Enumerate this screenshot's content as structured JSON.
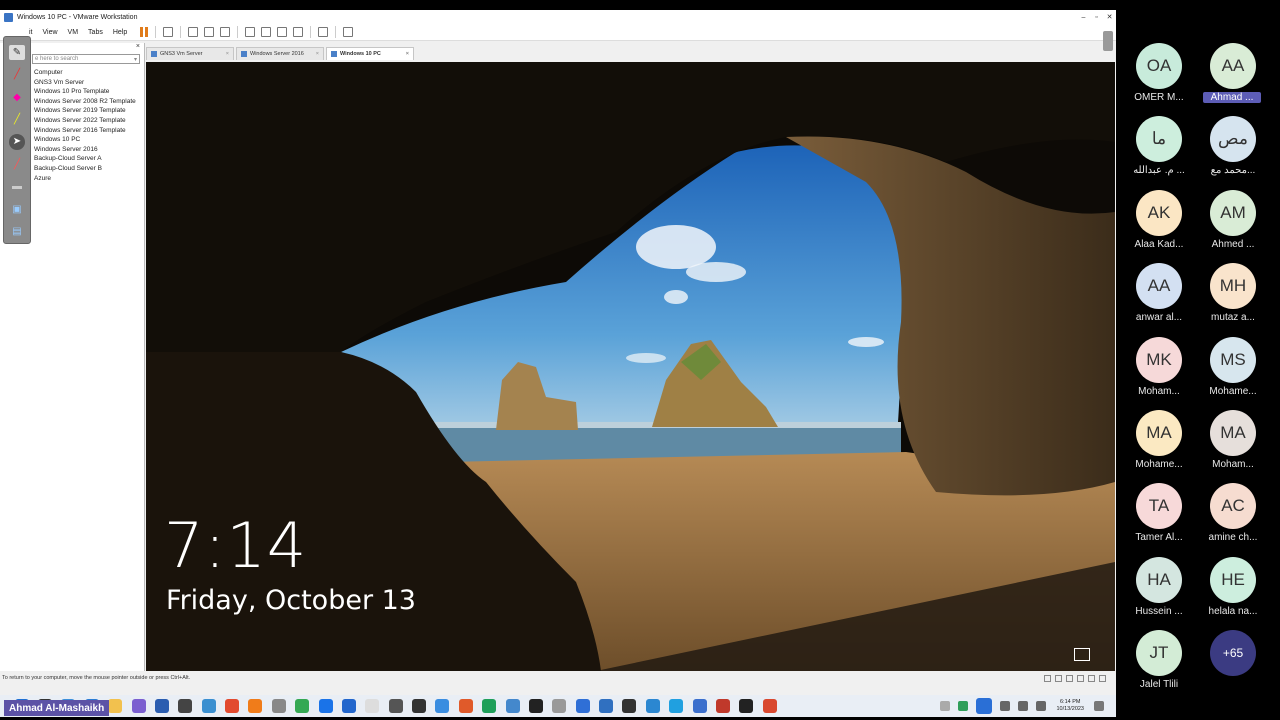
{
  "window": {
    "title": "Windows 10 PC - VMware Workstation",
    "minimize": "–",
    "maximize": "▫",
    "close": "✕"
  },
  "menubar": {
    "items": [
      "it",
      "View",
      "VM",
      "Tabs",
      "Help"
    ]
  },
  "library": {
    "close": "×",
    "search_placeholder": "e here to search",
    "search_arrow": "▾",
    "items": [
      {
        "label": "Computer",
        "root": true
      },
      {
        "label": "GNS3 Vm Server"
      },
      {
        "label": "Windows 10 Pro Template"
      },
      {
        "label": "Windows Server 2008 R2 Template"
      },
      {
        "label": "Windows Server 2019 Template"
      },
      {
        "label": "Windows Server 2022 Template"
      },
      {
        "label": "Windows Server 2016 Template"
      },
      {
        "label": "Windows 10 PC"
      },
      {
        "label": "Windows Server 2016"
      },
      {
        "label": "Backup-Cloud Server A"
      },
      {
        "label": "Backup-Cloud Server B"
      },
      {
        "label": "Azure"
      }
    ]
  },
  "tabs": [
    {
      "label": "GNS3 Vm Server",
      "close": "×",
      "active": false
    },
    {
      "label": "Windows Server 2016",
      "close": "×",
      "active": false
    },
    {
      "label": "Windows 10 PC",
      "close": "×",
      "active": true
    }
  ],
  "lockscreen": {
    "time": "7:14",
    "date": "Friday, October 13"
  },
  "statusbar": {
    "text": "To return to your computer, move the mouse pointer outside or press Ctrl+Alt."
  },
  "taskbar": {
    "icon_colors": [
      "#1f6fd1",
      "#333333",
      "#3c8fd9",
      "#2b7cd3",
      "#f2c14e",
      "#7b5fd0",
      "#2a5db0",
      "#444444",
      "#3a8fd0",
      "#e24a2f",
      "#f07c1a",
      "#888888",
      "#34a853",
      "#1a73e8",
      "#2266cc",
      "#dddddd",
      "#555555",
      "#333333",
      "#3a8de0",
      "#e05a2a",
      "#1f9f5a",
      "#4488cc",
      "#222222",
      "#999999",
      "#2f6fd6",
      "#3070c0",
      "#333333",
      "#2b87d1",
      "#20a0e0",
      "#3b6fcd",
      "#c0392b",
      "#222222",
      "#d9482f"
    ],
    "tray": {
      "time": "6:14 PM",
      "date": "10/13/2023"
    }
  },
  "presenter": "Ahmad Al-Mashaikh",
  "participants": [
    {
      "initials": "OA",
      "name": "OMER M...",
      "bg": "#c8ebdb"
    },
    {
      "initials": "AA",
      "name": "Ahmad ...",
      "bg": "#d9ecd6",
      "highlight": true
    },
    {
      "initials": "ما",
      "name": "م. عبدالله ...",
      "bg": "#cdeedd"
    },
    {
      "initials": "مص",
      "name": "محمد مع...",
      "bg": "#d6e4ef"
    },
    {
      "initials": "AK",
      "name": "Alaa Kad...",
      "bg": "#fbe6c4"
    },
    {
      "initials": "AM",
      "name": "Ahmed  ...",
      "bg": "#d9ecd6"
    },
    {
      "initials": "AA",
      "name": "anwar al...",
      "bg": "#d3e0f2"
    },
    {
      "initials": "MH",
      "name": "mutaz a...",
      "bg": "#f9e4cc"
    },
    {
      "initials": "MK",
      "name": "Moham...",
      "bg": "#f6d9d9"
    },
    {
      "initials": "MS",
      "name": "Mohame...",
      "bg": "#d7e6ee"
    },
    {
      "initials": "MA",
      "name": "Mohame...",
      "bg": "#fbe9c2"
    },
    {
      "initials": "MA",
      "name": "Moham...",
      "bg": "#e6dfdb"
    },
    {
      "initials": "TA",
      "name": "Tamer Al...",
      "bg": "#f7d9d9"
    },
    {
      "initials": "AC",
      "name": "amine ch...",
      "bg": "#f6dcd0"
    },
    {
      "initials": "HA",
      "name": "Hussein ...",
      "bg": "#d4e6e0"
    },
    {
      "initials": "HE",
      "name": "helala na...",
      "bg": "#cdeede"
    },
    {
      "initials": "JT",
      "name": "Jalel Tlili",
      "bg": "#d3ecd6"
    },
    {
      "initials": "+65",
      "name": "",
      "bg": "#3b3b82",
      "more": true
    }
  ]
}
